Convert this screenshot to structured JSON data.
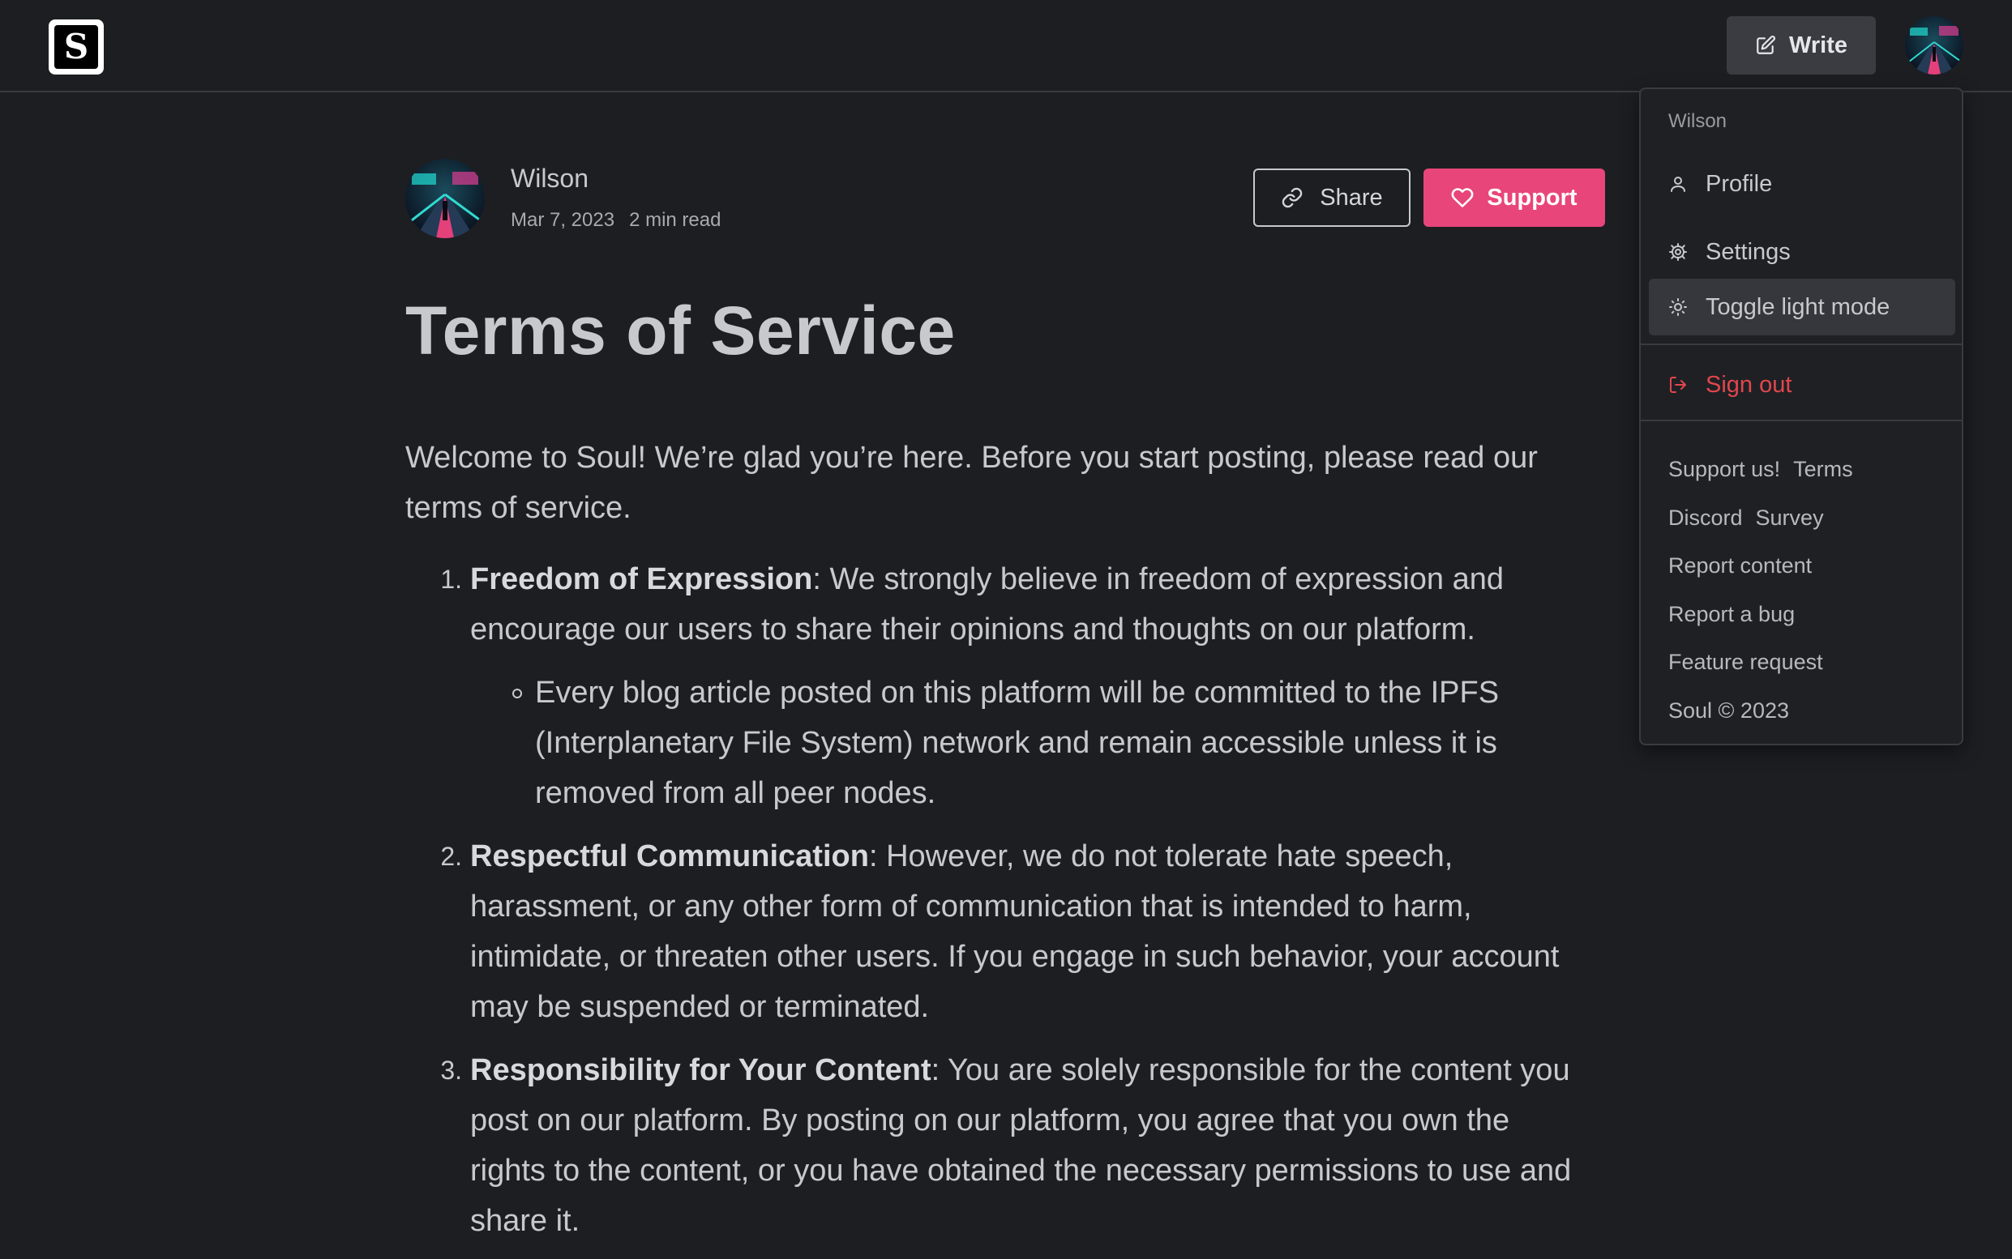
{
  "header": {
    "logo_letter": "S",
    "write_label": "Write"
  },
  "author": {
    "name": "Wilson",
    "date": "Mar 7, 2023",
    "read_time": "2 min read"
  },
  "actions": {
    "share_label": "Share",
    "support_label": "Support",
    "support_color": "#e8457a"
  },
  "article": {
    "title": "Terms of Service",
    "intro": "Welcome to Soul! We’re glad you’re here. Before you start posting, please read our terms of service.",
    "items": [
      {
        "number": "1.",
        "heading": "Freedom of Expression",
        "text": ": We strongly believe in freedom of expression and encourage our users to share their opinions and thoughts on our platform.",
        "sub": "Every blog article posted on this platform will be committed to the IPFS (Interplanetary File System) network and remain accessible unless it is removed from all peer nodes."
      },
      {
        "number": "2.",
        "heading": "Respectful Communication",
        "text": ": However, we do not tolerate hate speech, harassment, or any other form of communication that is intended to harm, intimidate, or threaten other users. If you engage in such behavior, your account may be suspended or terminated."
      },
      {
        "number": "3.",
        "heading": "Responsibility for Your Content",
        "text": ": You are solely responsible for the content you post on our platform. By posting on our platform, you agree that you own the rights to the content, or you have obtained the necessary permissions to use and share it."
      }
    ]
  },
  "menu": {
    "username": "Wilson",
    "items": [
      {
        "label": "Profile",
        "icon": "user-icon"
      },
      {
        "label": "Settings",
        "icon": "gear-icon"
      },
      {
        "label": "Toggle light mode",
        "icon": "sun-icon"
      },
      {
        "label": "Sign out",
        "icon": "sign-out-icon"
      }
    ],
    "links": {
      "support_us": "Support us!",
      "terms": "Terms",
      "discord": "Discord",
      "survey": "Survey",
      "report_content": "Report content",
      "report_bug": "Report a bug",
      "feature_request": "Feature request",
      "copyright": "Soul © 2023"
    },
    "danger_color": "#e0474c"
  }
}
